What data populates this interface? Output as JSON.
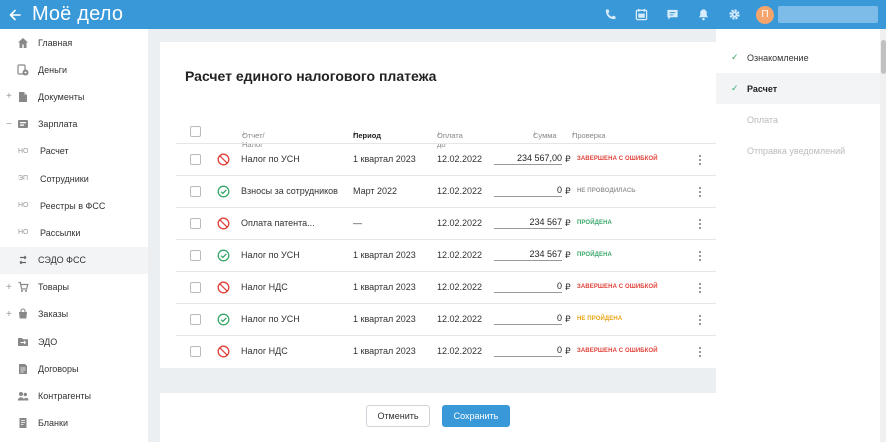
{
  "header": {
    "back_icon": "arrow-left-icon",
    "logo": "Moё дело",
    "icons": [
      "phone-icon",
      "calendar-icon",
      "chat-icon",
      "bell-icon",
      "gear-icon"
    ],
    "avatar_letter": "П"
  },
  "sidebar": {
    "items": [
      {
        "label": "Главная",
        "icon": "home-icon"
      },
      {
        "label": "Деньги",
        "icon": "money-icon"
      },
      {
        "label": "Документы",
        "icon": "documents-icon",
        "expandable": true
      },
      {
        "label": "Зарплата",
        "icon": "salary-icon",
        "expanded": true
      },
      {
        "label": "Расчет",
        "abbr": "НО"
      },
      {
        "label": "Сотрудники",
        "abbr": "ЭП"
      },
      {
        "label": "Реестры в ФСС",
        "abbr": "НО"
      },
      {
        "label": "Рассылки",
        "abbr": "НО"
      },
      {
        "label": "СЭДО ФСС",
        "icon": "sedo-icon",
        "active": true
      },
      {
        "label": "Товары",
        "icon": "goods-icon",
        "expandable": true
      },
      {
        "label": "Заказы",
        "icon": "orders-icon",
        "expandable": true
      },
      {
        "label": "ЭДО",
        "icon": "edo-icon"
      },
      {
        "label": "Договоры",
        "icon": "contracts-icon"
      },
      {
        "label": "Контрагенты",
        "icon": "contractors-icon"
      },
      {
        "label": "Бланки",
        "icon": "forms-icon"
      }
    ]
  },
  "main": {
    "title": "Расчет единого налогового платежа",
    "columns": {
      "report": "Отчет/ Налог",
      "period": "Период",
      "pay_until": "Оплата до",
      "sum": "Сумма",
      "check": "Проверка"
    },
    "rows": [
      {
        "status": "error",
        "name": "Налог по УСН",
        "period": "1 квартал 2023",
        "date": "12.02.2022",
        "sum": "234 567,00",
        "currency": "₽",
        "check": "ЗАВЕРШЕНА С ОШИБКОЙ",
        "check_type": "error"
      },
      {
        "status": "ok",
        "name": "Взносы за сотрудников",
        "period": "Март 2022",
        "date": "12.02.2022",
        "sum": "0",
        "currency": "₽",
        "check": "НЕ ПРОВОДИЛАСЬ",
        "check_type": "none"
      },
      {
        "status": "error",
        "name": "Оплата патента...",
        "period": "—",
        "date": "12.02.2022",
        "sum": "234 567",
        "currency": "₽",
        "check": "ПРОЙДЕНА",
        "check_type": "passed"
      },
      {
        "status": "ok",
        "name": "Налог по УСН",
        "period": "1 квартал 2023",
        "date": "12.02.2022",
        "sum": "234 567",
        "currency": "₽",
        "check": "ПРОЙДЕНА",
        "check_type": "passed"
      },
      {
        "status": "error",
        "name": "Налог НДС",
        "period": "1 квартал 2023",
        "date": "12.02.2022",
        "sum": "0",
        "currency": "₽",
        "check": "ЗАВЕРШЕНА С ОШИБКОЙ",
        "check_type": "error"
      },
      {
        "status": "ok",
        "name": "Налог по УСН",
        "period": "1 квартал 2023",
        "date": "12.02.2022",
        "sum": "0",
        "currency": "₽",
        "check": "НЕ ПРОЙДЕНА",
        "check_type": "failed"
      },
      {
        "status": "error",
        "name": "Налог НДС",
        "period": "1 квартал 2023",
        "date": "12.02.2022",
        "sum": "0",
        "currency": "₽",
        "check": "ЗАВЕРШЕНА С ОШИБКОЙ",
        "check_type": "error"
      }
    ]
  },
  "footer": {
    "cancel_label": "Отменить",
    "save_label": "Сохранить"
  },
  "steps": [
    {
      "label": "Ознакомление",
      "state": "done"
    },
    {
      "label": "Расчет",
      "state": "current"
    },
    {
      "label": "Оплата",
      "state": "todo"
    },
    {
      "label": "Отправка уведомлений",
      "state": "todo"
    }
  ],
  "colors": {
    "brand": "#3898d8",
    "error": "#e0413a",
    "ok": "#3aa86b",
    "passed": "#3aa86b",
    "failed": "#e8a317",
    "none": "#999999"
  }
}
